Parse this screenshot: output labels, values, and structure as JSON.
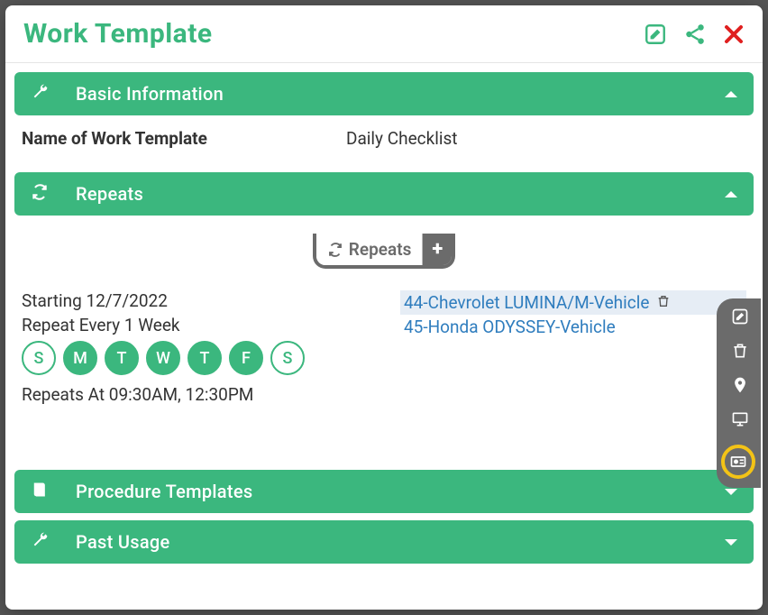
{
  "header": {
    "title": "Work Template"
  },
  "sections": {
    "basic": {
      "title": "Basic Information",
      "name_label": "Name of Work Template",
      "name_value": "Daily Checklist"
    },
    "repeats": {
      "title": "Repeats",
      "button_label": "Repeats",
      "starting": "Starting 12/7/2022",
      "every": "Repeat Every 1 Week",
      "times": "Repeats At 09:30AM, 12:30PM",
      "days": [
        {
          "label": "S",
          "on": false
        },
        {
          "label": "M",
          "on": true
        },
        {
          "label": "T",
          "on": true
        },
        {
          "label": "W",
          "on": true
        },
        {
          "label": "T",
          "on": true
        },
        {
          "label": "F",
          "on": true
        },
        {
          "label": "S",
          "on": false
        }
      ],
      "vehicles": [
        {
          "label": "44-Chevrolet LUMINA/M-Vehicle",
          "selected": true
        },
        {
          "label": "45-Honda ODYSSEY-Vehicle",
          "selected": false
        }
      ]
    },
    "procedures": {
      "title": "Procedure Templates"
    },
    "past": {
      "title": "Past Usage"
    }
  }
}
